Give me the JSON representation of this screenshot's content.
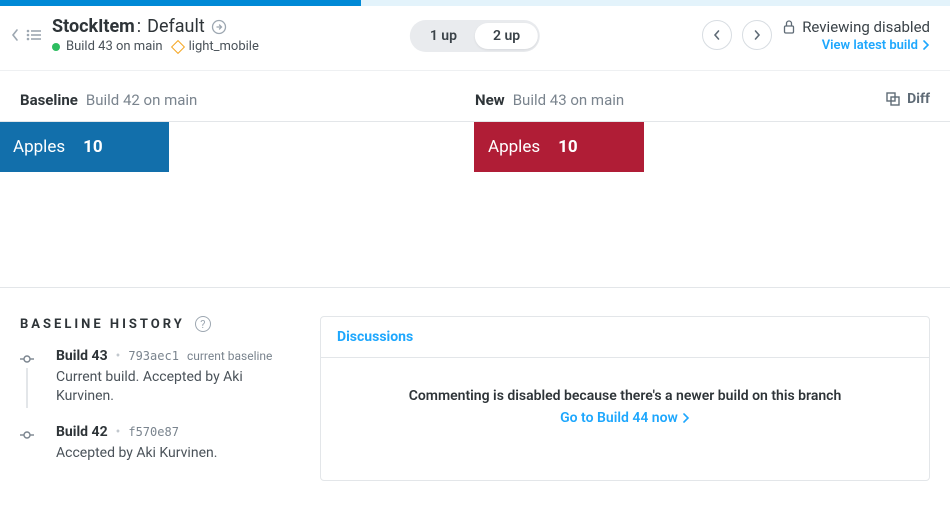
{
  "header": {
    "component": "StockItem",
    "separator": ":",
    "story": "Default",
    "build_label": "Build 43 on main",
    "theme_tag": "light_mobile"
  },
  "toggle": {
    "opt1": "1 up",
    "opt2": "2 up"
  },
  "right": {
    "reviewing_label": "Reviewing disabled",
    "view_latest": "View latest build"
  },
  "compare": {
    "baseline_label": "Baseline",
    "baseline_build": "Build 42 on main",
    "new_label": "New",
    "new_build": "Build 43 on main",
    "diff_label": "Diff"
  },
  "snapshot": {
    "item_name": "Apples",
    "item_count": "10"
  },
  "history": {
    "title": "BASELINE HISTORY",
    "entries": [
      {
        "build": "Build 43",
        "hash": "793aec1",
        "tag": "current baseline",
        "desc": "Current build. Accepted by Aki Kurvinen."
      },
      {
        "build": "Build 42",
        "hash": "f570e87",
        "tag": "",
        "desc": "Accepted by Aki Kurvinen."
      }
    ]
  },
  "discussions": {
    "tab_label": "Discussions",
    "message": "Commenting is disabled because there's a newer build on this branch",
    "link_text": "Go to Build 44 now"
  }
}
